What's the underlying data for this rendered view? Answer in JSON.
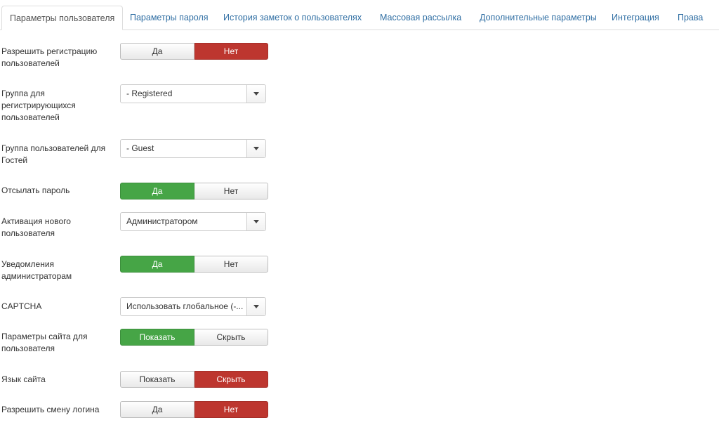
{
  "tabs": [
    {
      "label": "Параметры пользователя",
      "active": true
    },
    {
      "label": "Параметры пароля",
      "active": false
    },
    {
      "label": "История заметок о пользователях",
      "active": false
    },
    {
      "label": "Массовая рассылка",
      "active": false
    },
    {
      "label": "Дополнительные параметры",
      "active": false
    },
    {
      "label": "Интеграция",
      "active": false
    },
    {
      "label": "Права",
      "active": false
    }
  ],
  "fields": {
    "allow_registration": {
      "label": "Разрешить регистрацию пользователей",
      "option_a": "Да",
      "option_b": "Нет",
      "selected": "Нет"
    },
    "new_user_group": {
      "label": "Группа для регистрирующихся пользователей",
      "value": "- Registered"
    },
    "guest_group": {
      "label": "Группа пользователей для Гостей",
      "value": "- Guest"
    },
    "send_password": {
      "label": "Отсылать пароль",
      "option_a": "Да",
      "option_b": "Нет",
      "selected": "Да"
    },
    "new_user_activation": {
      "label": "Активация нового пользователя",
      "value": "Администратором"
    },
    "notify_admins": {
      "label": "Уведомления администраторам",
      "option_a": "Да",
      "option_b": "Нет",
      "selected": "Да"
    },
    "captcha": {
      "label": "CAPTCHA",
      "value": "Использовать глобальное (-..."
    },
    "frontend_params": {
      "label": "Параметры сайта для пользователя",
      "option_a": "Показать",
      "option_b": "Скрыть",
      "selected": "Показать"
    },
    "site_language": {
      "label": "Язык сайта",
      "option_a": "Показать",
      "option_b": "Скрыть",
      "selected": "Скрыть"
    },
    "allow_username_change": {
      "label": "Разрешить смену логина",
      "option_a": "Да",
      "option_b": "Нет",
      "selected": "Нет"
    }
  },
  "colors": {
    "link": "#2f6ea3",
    "on_green": "#46a546",
    "off_red": "#bd362f",
    "border": "#dddddd"
  }
}
